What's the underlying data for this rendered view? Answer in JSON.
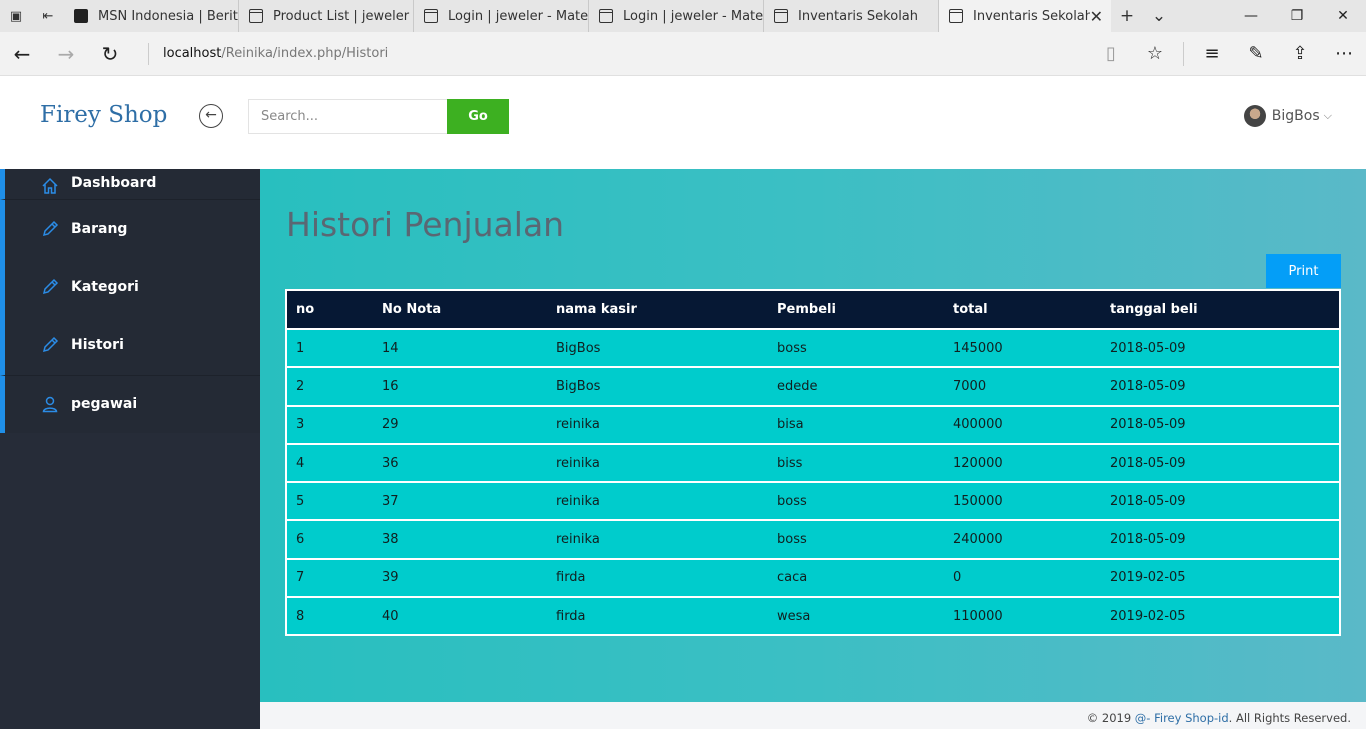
{
  "browser": {
    "tabs": [
      {
        "label": "MSN Indonesia | Berita",
        "icon": "msn-icon"
      },
      {
        "label": "Product List | jeweler - I",
        "icon": "page-icon"
      },
      {
        "label": "Login | jeweler - Materi",
        "icon": "page-icon"
      },
      {
        "label": "Login | jeweler - Materi",
        "icon": "page-icon"
      },
      {
        "label": "Inventaris Sekolah",
        "icon": "page-icon"
      },
      {
        "label": "Inventaris Sekolah",
        "icon": "page-icon",
        "active": true
      }
    ],
    "url_host": "localhost",
    "url_path": "/Reinika/index.php/Histori"
  },
  "header": {
    "brand": "Firey Shop",
    "search_placeholder": "Search...",
    "go_label": "Go",
    "user_name": "BigBos"
  },
  "sidebar": {
    "items": [
      {
        "label": "Dashboard",
        "icon": "home-icon"
      },
      {
        "label": "Barang",
        "icon": "pencil-icon"
      },
      {
        "label": "Kategori",
        "icon": "pencil-icon"
      },
      {
        "label": "Histori",
        "icon": "pencil-icon"
      },
      {
        "label": "pegawai",
        "icon": "user-icon"
      }
    ]
  },
  "main": {
    "title": "Histori Penjualan",
    "print_label": "Print",
    "table": {
      "headers": [
        "no",
        "No Nota",
        "nama kasir",
        "Pembeli",
        "total",
        "tanggal beli"
      ],
      "rows": [
        [
          "1",
          "14",
          "BigBos",
          "boss",
          "145000",
          "2018-05-09"
        ],
        [
          "2",
          "16",
          "BigBos",
          "edede",
          "7000",
          "2018-05-09"
        ],
        [
          "3",
          "29",
          "reinika",
          "bisa",
          "400000",
          "2018-05-09"
        ],
        [
          "4",
          "36",
          "reinika",
          "biss",
          "120000",
          "2018-05-09"
        ],
        [
          "5",
          "37",
          "reinika",
          "boss",
          "150000",
          "2018-05-09"
        ],
        [
          "6",
          "38",
          "reinika",
          "boss",
          "240000",
          "2018-05-09"
        ],
        [
          "7",
          "39",
          "firda",
          "caca",
          "0",
          "2019-02-05"
        ],
        [
          "8",
          "40",
          "firda",
          "wesa",
          "110000",
          "2019-02-05"
        ]
      ]
    }
  },
  "footer": {
    "prefix": "© 2019 ",
    "link": "@- Firey Shop-id",
    "suffix": ". All Rights Reserved."
  },
  "colors": {
    "brand": "#2e6ea6",
    "go_button": "#3db021",
    "print_button": "#049ef7",
    "sidebar_bg": "#262c38",
    "sidebar_accent": "#1f8fe8",
    "table_header": "#061834",
    "table_row": "#00cccc"
  }
}
